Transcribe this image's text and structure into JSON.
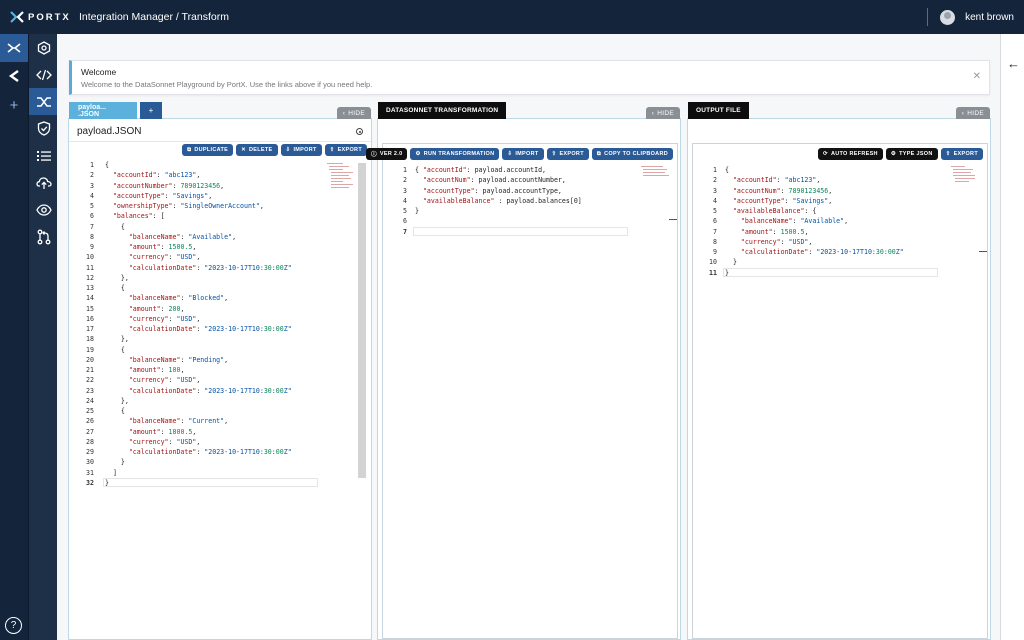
{
  "app": {
    "logo_text": "PORTX",
    "breadcrumb": "Integration Manager / Transform"
  },
  "user": {
    "name": "kent brown"
  },
  "welcome": {
    "title": "Welcome",
    "text": "Welcome to the DataSonnet Playground by PortX. Use the links above if you need help."
  },
  "panels": {
    "input": {
      "tab_label": "payloa... .JSON",
      "add_label": "+",
      "hide_label": "HIDE",
      "file_title": "payload.JSON",
      "buttons": [
        "DUPLICATE",
        "DELETE",
        "IMPORT",
        "EXPORT"
      ],
      "lines": [
        "{",
        "  \"accountId\": \"abc123\",",
        "  \"accountNumber\": 7890123456,",
        "  \"accountType\": \"Savings\",",
        "  \"ownershipType\": \"SingleOwnerAccount\",",
        "  \"balances\": [",
        "    {",
        "      \"balanceName\": \"Available\",",
        "      \"amount\": 1500.5,",
        "      \"currency\": \"USD\",",
        "      \"calculationDate\": \"2023-10-17T10:30:00Z\"",
        "    },",
        "    {",
        "      \"balanceName\": \"Blocked\",",
        "      \"amount\": 200,",
        "      \"currency\": \"USD\",",
        "      \"calculationDate\": \"2023-10-17T10:30:00Z\"",
        "    },",
        "    {",
        "      \"balanceName\": \"Pending\",",
        "      \"amount\": 100,",
        "      \"currency\": \"USD\",",
        "      \"calculationDate\": \"2023-10-17T10:30:00Z\"",
        "    },",
        "    {",
        "      \"balanceName\": \"Current\",",
        "      \"amount\": 1800.5,",
        "      \"currency\": \"USD\",",
        "      \"calculationDate\": \"2023-10-17T10:30:00Z\"",
        "    }",
        "  ]",
        "}"
      ]
    },
    "transform": {
      "tab_label": "DATASONNET TRANSFORMATION",
      "hide_label": "HIDE",
      "buttons": [
        "VER 2.0",
        "RUN TRANSFORMATION",
        "IMPORT",
        "EXPORT",
        "COPY TO CLIPBOARD"
      ],
      "lines": [
        "{ \"accountId\": payload.accountId,",
        "  \"accountNum\": payload.accountNumber,",
        "  \"accountType\": payload.accountType,",
        "  \"availableBalance\" : payload.balances[0]",
        "}",
        "",
        ""
      ]
    },
    "output": {
      "tab_label": "OUTPUT FILE",
      "hide_label": "HIDE",
      "buttons": [
        "AUTO REFRESH",
        "TYPE JSON",
        "EXPORT"
      ],
      "lines": [
        "{",
        "  \"accountId\": \"abc123\",",
        "  \"accountNum\": 7890123456,",
        "  \"accountType\": \"Savings\",",
        "  \"availableBalance\": {",
        "    \"balanceName\": \"Available\",",
        "    \"amount\": 1500.5,",
        "    \"currency\": \"USD\",",
        "    \"calculationDate\": \"2023-10-17T10:30:00Z\"",
        "  }",
        "}"
      ]
    }
  },
  "help_label": "?"
}
